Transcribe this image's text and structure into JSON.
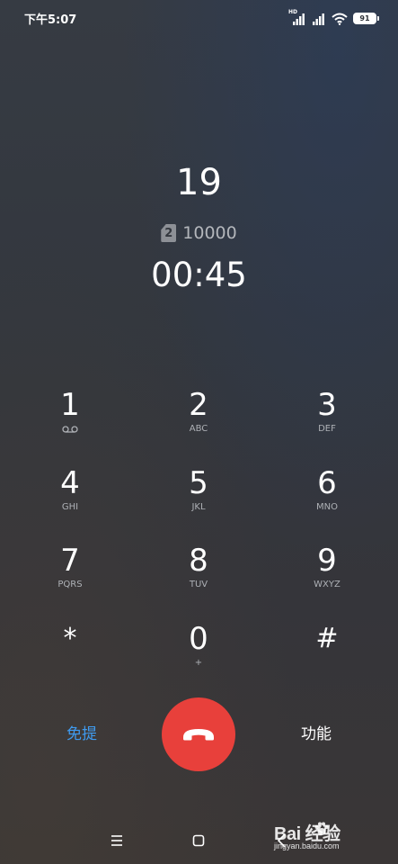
{
  "status_bar": {
    "time": "下午5:07",
    "hd_label": "HD",
    "battery_level": "91",
    "icons": [
      "hd-signal-icon",
      "signal-icon",
      "wifi-icon",
      "battery-icon"
    ]
  },
  "call": {
    "caller": "19",
    "sim_slot": "2",
    "sim_number": "10000",
    "duration": "00:45"
  },
  "keypad": {
    "keys": [
      {
        "digit": "1",
        "letters": "",
        "icon": "voicemail-icon"
      },
      {
        "digit": "2",
        "letters": "ABC"
      },
      {
        "digit": "3",
        "letters": "DEF"
      },
      {
        "digit": "4",
        "letters": "GHI"
      },
      {
        "digit": "5",
        "letters": "JKL"
      },
      {
        "digit": "6",
        "letters": "MNO"
      },
      {
        "digit": "7",
        "letters": "PQRS"
      },
      {
        "digit": "8",
        "letters": "TUV"
      },
      {
        "digit": "9",
        "letters": "WXYZ"
      },
      {
        "digit": "*",
        "letters": ""
      },
      {
        "digit": "0",
        "letters": "+"
      },
      {
        "digit": "#",
        "letters": ""
      }
    ]
  },
  "actions": {
    "speaker_label": "免提",
    "more_label": "功能",
    "end_call_icon": "hang-up-icon",
    "colors": {
      "end_call": "#e8403b",
      "speaker": "#3f9bf0"
    }
  },
  "nav": {
    "icons": [
      "menu-icon",
      "home-icon",
      "back-icon"
    ]
  },
  "watermark": {
    "brand": "Bai  经验",
    "url": "jingyan.baidu.com"
  }
}
